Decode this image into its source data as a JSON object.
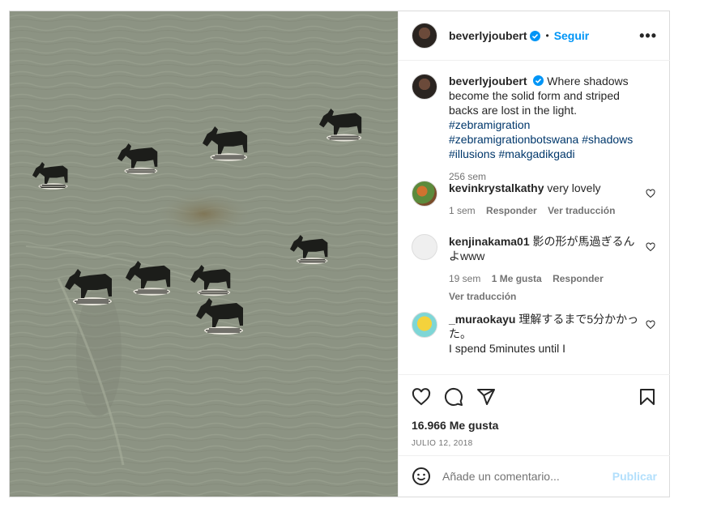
{
  "post": {
    "author": "beverlyjoubert",
    "follow_label": "Seguir",
    "separator": "•",
    "more_label": "•••",
    "caption": {
      "text": "Where shadows become the solid form and striped backs are lost in the light.",
      "hashtags": [
        "#zebramigration",
        "#zebramigrationbotswana",
        "#shadows",
        "#illusions",
        "#makgadikgadi"
      ],
      "time": "256 sem"
    },
    "likes": "16.966 Me gusta",
    "date": "JULIO 12, 2018"
  },
  "comments": [
    {
      "user": "kevinkrystalkathy",
      "text": "very lovely",
      "time": "1 sem",
      "likes": "",
      "reply": "Responder",
      "translate": "Ver traducción"
    },
    {
      "user": "kenjinakama01",
      "text": "影の形が馬過ぎるんよwww",
      "time": "19 sem",
      "likes": "1 Me gusta",
      "reply": "Responder",
      "translate": "Ver traducción"
    },
    {
      "user": "_muraokayu",
      "text": "理解するまで5分かかった。",
      "text2": "I spend 5minutes until I",
      "time": "",
      "likes": "",
      "reply": "",
      "translate": ""
    }
  ],
  "composer": {
    "placeholder": "Añade un comentario...",
    "publish_label": "Publicar"
  },
  "icons": [
    "like-icon",
    "comment-icon",
    "share-icon",
    "save-icon",
    "emoji-icon",
    "verified-icon",
    "small-heart-icon"
  ],
  "colors": {
    "accent": "#0095f6",
    "hashtag": "#00376b",
    "publish_disabled": "#b2dffc",
    "muted": "#737373"
  }
}
